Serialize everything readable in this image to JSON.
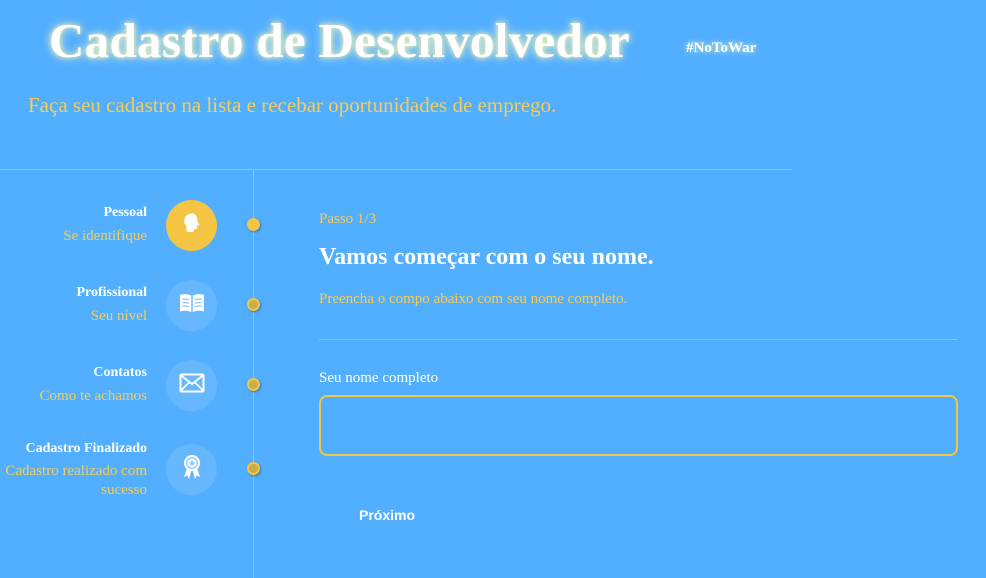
{
  "header": {
    "title": "Cadastro de Desenvolvedor",
    "hashtag": "#NoToWar",
    "subtitle": "Faça seu cadastro na lista e recebar oportunidades de emprego."
  },
  "steps": [
    {
      "title": "Pessoal",
      "description": "Se identifique",
      "icon": "person-head-icon",
      "active": true
    },
    {
      "title": "Profissional",
      "description": "Seu nível",
      "icon": "book-icon",
      "active": false
    },
    {
      "title": "Contatos",
      "description": "Como te achamos",
      "icon": "envelope-icon",
      "active": false
    },
    {
      "title": "Cadastro Finalizado",
      "description": "Cadastro realizado com sucesso",
      "icon": "award-badge-icon",
      "active": false
    }
  ],
  "form": {
    "step_indicator": "Passo 1/3",
    "heading": "Vamos começar com o seu nome.",
    "helper": "Preencha o compo abaixo com seu nome completo.",
    "field_label": "Seu nome completo",
    "field_value": "",
    "field_placeholder": "",
    "next_label": "Próximo"
  },
  "colors": {
    "background": "#52aeff",
    "accent": "#f4c542",
    "accent_text": "#f5cd56",
    "text": "#ffffff"
  }
}
